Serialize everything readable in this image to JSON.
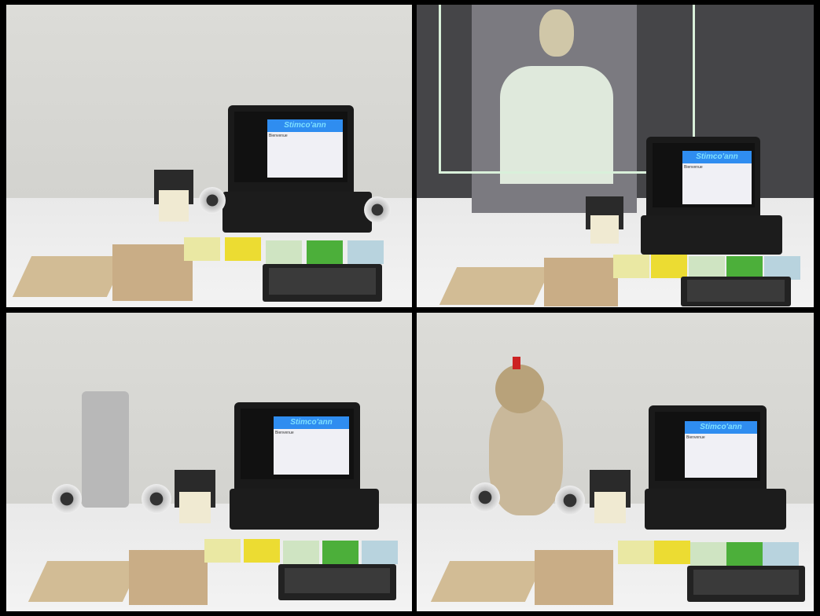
{
  "panels": [
    {
      "name": "panel-laptop"
    },
    {
      "name": "panel-avatar"
    },
    {
      "name": "panel-robot"
    },
    {
      "name": "panel-turtle"
    }
  ],
  "app": {
    "title": "Stimco'ann",
    "line": "Bienvenue"
  },
  "colors": {
    "cards": [
      "#eae8a3",
      "#ecdc32",
      "#cfe4c2",
      "#4caf3a",
      "#b8d3de"
    ]
  }
}
